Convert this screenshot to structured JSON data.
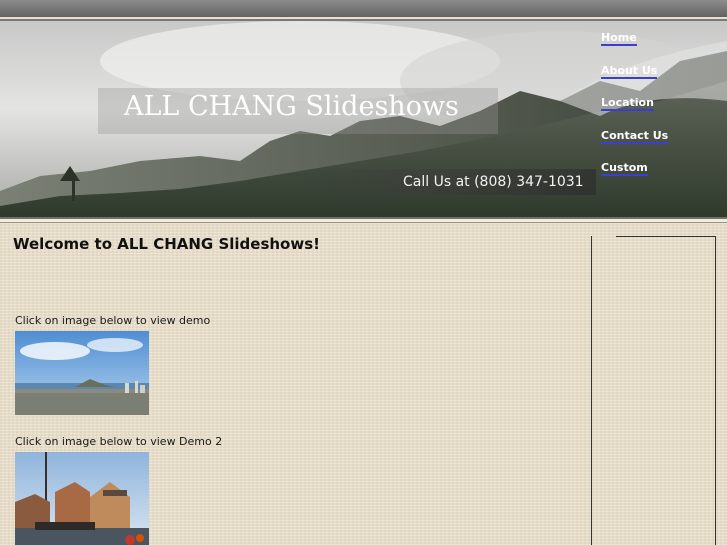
{
  "header": {
    "site_title": "ALL CHANG Slideshows",
    "phone_text": "Call Us at (808) 347-1031"
  },
  "nav": {
    "items": [
      {
        "label": "Home"
      },
      {
        "label": "About Us"
      },
      {
        "label": "Location"
      },
      {
        "label": "Contact Us"
      },
      {
        "label": "Custom"
      }
    ]
  },
  "main": {
    "welcome": "Welcome to ALL CHANG Slideshows!",
    "demos": [
      {
        "caption": "Click on image below to view demo"
      },
      {
        "caption": "Click on image below to view Demo 2"
      }
    ]
  },
  "colors": {
    "background": "#ece2cd",
    "nav_underline": "#3b3fd0",
    "text": "#111111"
  }
}
